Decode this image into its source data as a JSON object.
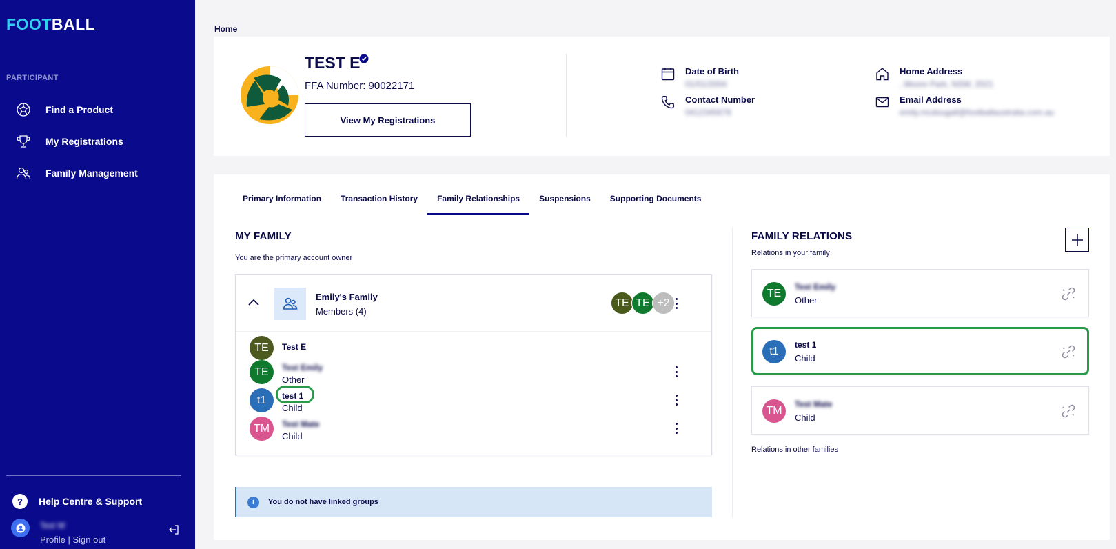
{
  "sidebar": {
    "logo_a": "FOOT",
    "logo_b": "BALL",
    "section": "PARTICIPANT",
    "items": [
      {
        "label": "Find a Product",
        "icon": "soccer-ball-icon"
      },
      {
        "label": "My Registrations",
        "icon": "trophy-icon"
      },
      {
        "label": "Family Management",
        "icon": "users-icon"
      }
    ],
    "help": "Help Centre & Support",
    "user_name": "Test W",
    "profile_link": "Profile",
    "separator": "|",
    "signout_link": "Sign out"
  },
  "breadcrumb": "Home",
  "profile": {
    "name": "TEST E",
    "ffa_number": "FFA Number: 90022171",
    "view_registrations": "View My Registrations",
    "dob_label": "Date of Birth",
    "dob_value": "01/01/2004",
    "contact_label": "Contact Number",
    "contact_value": "0412345678",
    "address_label": "Home Address",
    "address_value": ", Moore Park, NSW, 2021",
    "email_label": "Email Address",
    "email_value": "emily.mcdougall@footballaustralia.com.au"
  },
  "tabs": [
    "Primary Information",
    "Transaction History",
    "Family Relationships",
    "Suspensions",
    "Supporting Documents"
  ],
  "active_tab": "Family Relationships",
  "my_family": {
    "title": "MY FAMILY",
    "subtitle": "You are the primary account owner",
    "family_name": "Emily's Family",
    "members_count": "Members (4)",
    "stack": [
      {
        "initials": "TE",
        "color": "#4a5a1a"
      },
      {
        "initials": "TE",
        "color": "#0f7a2e"
      },
      {
        "initials": "+2",
        "color": "#bdbdbd"
      }
    ],
    "members": [
      {
        "initials": "TE",
        "color": "#4d5a1f",
        "name": "Test E",
        "role": ""
      },
      {
        "initials": "TE",
        "color": "#0f7a2e",
        "name": "Test Emily",
        "role": "Other"
      },
      {
        "initials": "t1",
        "color": "#2a6eb8",
        "name": "test 1",
        "role": "Child"
      },
      {
        "initials": "TM",
        "color": "#d9558f",
        "name": "Test Mate",
        "role": "Child"
      }
    ],
    "linked_groups": "You do not have linked groups"
  },
  "relations": {
    "title": "FAMILY RELATIONS",
    "subtitle": "Relations in your family",
    "cards": [
      {
        "initials": "TE",
        "color": "#0f7a2e",
        "name": "Test Emily",
        "role": "Other"
      },
      {
        "initials": "t1",
        "color": "#2a6eb8",
        "name": "test 1",
        "role": "Child"
      },
      {
        "initials": "TM",
        "color": "#d9558f",
        "name": "Test Mate",
        "role": "Child"
      }
    ],
    "other_families": "Relations in other families"
  },
  "colors": {
    "sidebar": "#0a0a8c",
    "accent_cyan": "#2fd0f0",
    "highlight_green": "#2a9a4a",
    "info_bg": "#d7e6f7"
  }
}
